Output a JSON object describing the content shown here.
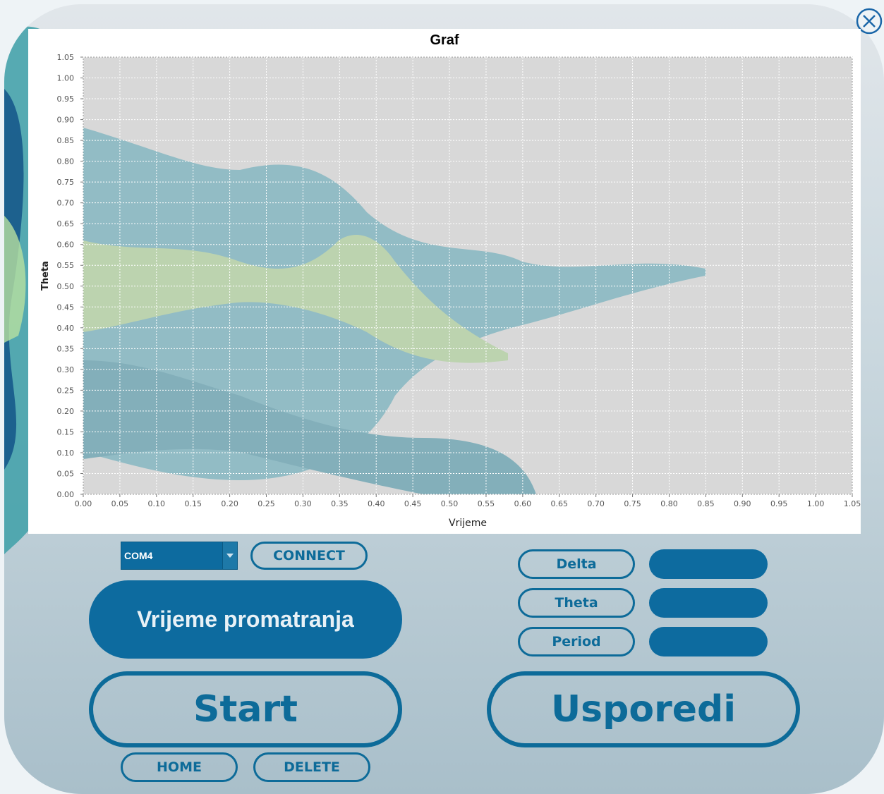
{
  "window": {
    "close_icon": "close-circle-icon"
  },
  "colors": {
    "accent": "#0d6b9f",
    "outline": "#0d6b99",
    "plot_bg": "#d8d8d8"
  },
  "chart_data": {
    "type": "line",
    "title": "Graf",
    "xlabel": "Vrijeme",
    "ylabel": "Theta",
    "xlim": [
      0,
      1.05
    ],
    "ylim": [
      0,
      1.05
    ],
    "x_ticks": [
      "0.00",
      "0.05",
      "0.10",
      "0.15",
      "0.20",
      "0.25",
      "0.30",
      "0.35",
      "0.40",
      "0.45",
      "0.50",
      "0.55",
      "0.60",
      "0.65",
      "0.70",
      "0.75",
      "0.80",
      "0.85",
      "0.90",
      "0.95",
      "1.00",
      "1.05"
    ],
    "y_ticks": [
      "0.00",
      "0.05",
      "0.10",
      "0.15",
      "0.20",
      "0.25",
      "0.30",
      "0.35",
      "0.40",
      "0.45",
      "0.50",
      "0.55",
      "0.60",
      "0.65",
      "0.70",
      "0.75",
      "0.80",
      "0.85",
      "0.90",
      "0.95",
      "1.00",
      "1.05"
    ],
    "grid": true,
    "series": []
  },
  "controls": {
    "port_select": {
      "value": "COM4"
    },
    "connect_label": "CONNECT",
    "observation_time_label": "Vrijeme promatranja",
    "start_label": "Start",
    "home_label": "HOME",
    "delete_label": "DELETE",
    "compare_label": "Usporedi"
  },
  "results": [
    {
      "label": "Delta",
      "value": ""
    },
    {
      "label": "Theta",
      "value": ""
    },
    {
      "label": "Period",
      "value": ""
    }
  ]
}
